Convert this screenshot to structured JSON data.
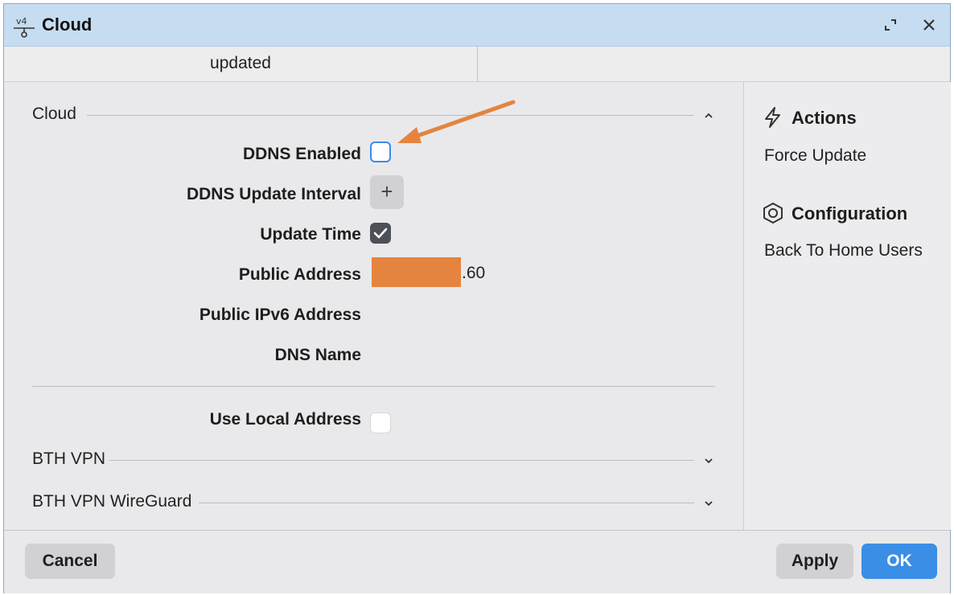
{
  "window": {
    "title": "Cloud",
    "title_icon": "ipv4-network-icon"
  },
  "tabs": [
    {
      "label": "updated"
    },
    {
      "label": ""
    }
  ],
  "sections": {
    "cloud": {
      "label": "Cloud",
      "expanded": true
    },
    "bth_vpn": {
      "label": "BTH VPN",
      "expanded": false
    },
    "bth_wireguard": {
      "label": "BTH VPN WireGuard",
      "expanded": false
    }
  },
  "fields": {
    "ddns_enabled": {
      "label": "DDNS Enabled",
      "checked": false
    },
    "ddns_interval": {
      "label": "DDNS Update Interval",
      "button": "+"
    },
    "update_time": {
      "label": "Update Time",
      "checked": true
    },
    "public_address": {
      "label": "Public Address",
      "value_suffix": ".60"
    },
    "public_ipv6": {
      "label": "Public IPv6 Address",
      "value": ""
    },
    "dns_name": {
      "label": "DNS Name",
      "value": ""
    },
    "use_local": {
      "label": "Use Local Address",
      "checked": false
    }
  },
  "sidebar": {
    "actions": {
      "title": "Actions",
      "icon": "lightning-icon",
      "items": [
        "Force Update"
      ]
    },
    "configuration": {
      "title": "Configuration",
      "icon": "hexagon-icon",
      "items": [
        "Back To Home Users"
      ]
    }
  },
  "footer": {
    "cancel": "Cancel",
    "apply": "Apply",
    "ok": "OK"
  },
  "colors": {
    "titlebar": "#c6dcf1",
    "accent": "#3a8ee6",
    "annotation_arrow": "#e4843e",
    "redaction": "#e4843e"
  }
}
